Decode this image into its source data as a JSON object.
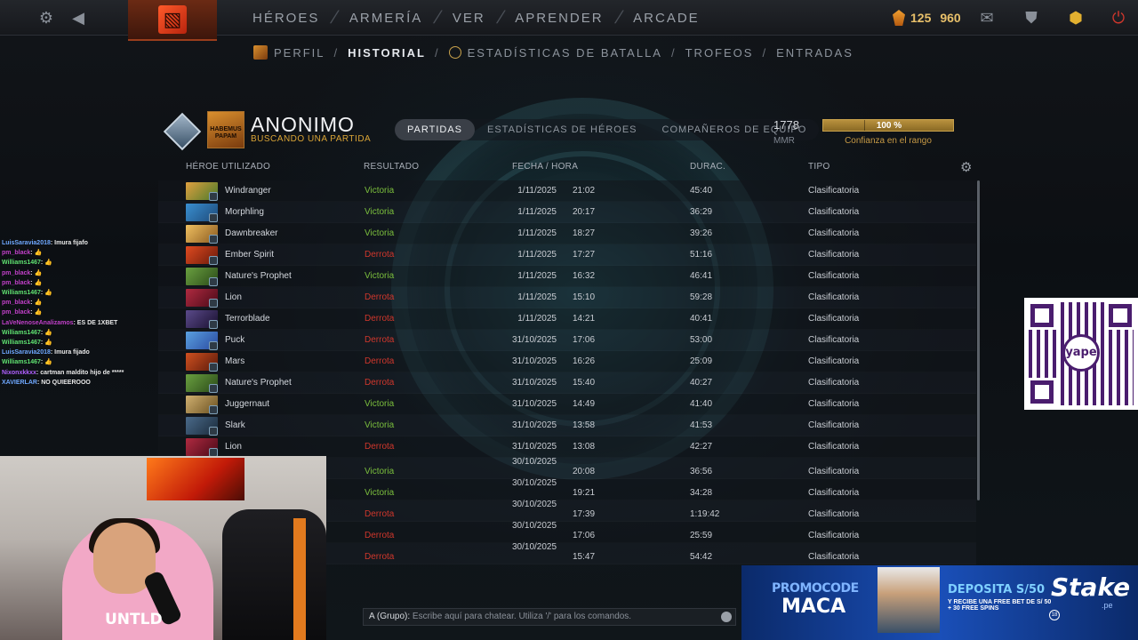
{
  "nav": {
    "items": [
      "HÉROES",
      "ARMERÍA",
      "VER",
      "APRENDER",
      "ARCADE"
    ],
    "currency": {
      "shards": "125",
      "gold": "960"
    }
  },
  "subnav": {
    "perfil": "PERFIL",
    "historial": "HISTORIAL",
    "battle_stats": "ESTADÍSTICAS DE BATALLA",
    "trofeos": "TROFEOS",
    "entradas": "ENTRADAS",
    "separator": "/"
  },
  "profile": {
    "name": "ANONIMO",
    "status": "BUSCANDO UNA PARTIDA",
    "avatar_text": "HABEMUS PAPAM",
    "tabs": [
      "PARTIDAS",
      "ESTADÍSTICAS DE HÉROES",
      "COMPAÑEROS DE EQUIPO"
    ],
    "mmr_value": "1778",
    "mmr_label": "MMR",
    "confidence_value": "100 %",
    "confidence_fraction": 1.0,
    "confidence_label": "Confianza en el rango"
  },
  "table": {
    "headers": [
      "HÉROE UTILIZADO",
      "RESULTADO",
      "FECHA / HORA",
      "DURAC.",
      "TIPO"
    ],
    "rows": [
      {
        "hero": "Windranger",
        "result": "Victoria",
        "date": "1/11/2025",
        "time": "21:02",
        "duration": "45:40",
        "type": "Clasificatoria"
      },
      {
        "hero": "Morphling",
        "result": "Victoria",
        "date": "1/11/2025",
        "time": "20:17",
        "duration": "36:29",
        "type": "Clasificatoria"
      },
      {
        "hero": "Dawnbreaker",
        "result": "Victoria",
        "date": "1/11/2025",
        "time": "18:27",
        "duration": "39:26",
        "type": "Clasificatoria"
      },
      {
        "hero": "Ember Spirit",
        "result": "Derrota",
        "date": "1/11/2025",
        "time": "17:27",
        "duration": "51:16",
        "type": "Clasificatoria"
      },
      {
        "hero": "Nature's Prophet",
        "result": "Victoria",
        "date": "1/11/2025",
        "time": "16:32",
        "duration": "46:41",
        "type": "Clasificatoria"
      },
      {
        "hero": "Lion",
        "result": "Derrota",
        "date": "1/11/2025",
        "time": "15:10",
        "duration": "59:28",
        "type": "Clasificatoria"
      },
      {
        "hero": "Terrorblade",
        "result": "Derrota",
        "date": "1/11/2025",
        "time": "14:21",
        "duration": "40:41",
        "type": "Clasificatoria"
      },
      {
        "hero": "Puck",
        "result": "Derrota",
        "date": "31/10/2025",
        "time": "17:06",
        "duration": "53:00",
        "type": "Clasificatoria"
      },
      {
        "hero": "Mars",
        "result": "Derrota",
        "date": "31/10/2025",
        "time": "16:26",
        "duration": "25:09",
        "type": "Clasificatoria"
      },
      {
        "hero": "Nature's Prophet",
        "result": "Derrota",
        "date": "31/10/2025",
        "time": "15:40",
        "duration": "40:27",
        "type": "Clasificatoria"
      },
      {
        "hero": "Juggernaut",
        "result": "Victoria",
        "date": "31/10/2025",
        "time": "14:49",
        "duration": "41:40",
        "type": "Clasificatoria"
      },
      {
        "hero": "Slark",
        "result": "Victoria",
        "date": "31/10/2025",
        "time": "13:58",
        "duration": "41:53",
        "type": "Clasificatoria"
      },
      {
        "hero": "Lion",
        "result": "Derrota",
        "date": "31/10/2025",
        "time": "13:08",
        "duration": "42:27",
        "type": "Clasificatoria"
      },
      {
        "hero": "",
        "result": "Victoria",
        "date": "30/10/2025",
        "time": "20:08",
        "duration": "36:56",
        "type": "Clasificatoria"
      },
      {
        "hero": "",
        "result": "Victoria",
        "date": "30/10/2025",
        "time": "19:21",
        "duration": "34:28",
        "type": "Clasificatoria"
      },
      {
        "hero": "",
        "result": "Derrota",
        "date": "30/10/2025",
        "time": "17:39",
        "duration": "1:19:42",
        "type": "Clasificatoria"
      },
      {
        "hero": "",
        "result": "Derrota",
        "date": "30/10/2025",
        "time": "17:06",
        "duration": "25:59",
        "type": "Clasificatoria"
      },
      {
        "hero": "",
        "result": "Derrota",
        "date": "30/10/2025",
        "time": "15:47",
        "duration": "54:42",
        "type": "Clasificatoria"
      }
    ]
  },
  "chat_log": [
    {
      "user": "LuisSaravia2018",
      "text": ": Imura fijafo",
      "cls": "u1"
    },
    {
      "user": "pm_black",
      "text": ": 👍",
      "cls": "u2"
    },
    {
      "user": "Williams1467",
      "text": ": 👍",
      "cls": "u3"
    },
    {
      "user": "pm_black",
      "text": ": 👍",
      "cls": "u2"
    },
    {
      "user": "pm_black",
      "text": ": 👍",
      "cls": "u2"
    },
    {
      "user": "Williams1467",
      "text": ": 👍",
      "cls": "u3"
    },
    {
      "user": "pm_black",
      "text": ": 👍",
      "cls": "u2"
    },
    {
      "user": "pm_black",
      "text": ": 👍",
      "cls": "u2"
    },
    {
      "user": "LaVeNenoseAnalizamos",
      "text": ": ES DE 1XBET",
      "cls": "u2"
    },
    {
      "user": "Williams1467",
      "text": ": 👍",
      "cls": "u3"
    },
    {
      "user": "Williams1467",
      "text": ": 👍",
      "cls": "u3"
    },
    {
      "user": "LuisSaravia2018",
      "text": ": Imura fijado",
      "cls": "u1"
    },
    {
      "user": "Williams1467",
      "text": ": 👍",
      "cls": "u3"
    },
    {
      "user": "Nixonxkkxx",
      "text": ": cartman maldito hijo de *****",
      "cls": "u4"
    },
    {
      "user": "XAVIERLAR",
      "text": ": NO QUIEEROOO",
      "cls": "u1"
    }
  ],
  "chat_input": {
    "channel": "A (Grupo):",
    "placeholder": "Escribe aquí para chatear. Utiliza '/' para los comandos."
  },
  "qr": {
    "logo_text": "yape"
  },
  "promo": {
    "label": "PROMOCODE",
    "code": "MACA",
    "deposit": "DEPOSITA S/50",
    "deposit_sub": "Y RECIBE UNA FREE BET DE S/ 50 + 30 FREE SPINS",
    "brand": "Stake",
    "brand_suffix": ".pe",
    "age": "18"
  },
  "webcam": {
    "shirt_text": "UNTLD"
  },
  "colors": {
    "win": "#7bbf3d",
    "loss": "#d0372c",
    "accent_gold": "#c9a24c"
  },
  "icons": [
    "settings-gear-icon",
    "back-arrow-icon",
    "mail-icon",
    "armory-icon",
    "plus-hex-icon",
    "power-icon",
    "rank-medal-icon"
  ]
}
